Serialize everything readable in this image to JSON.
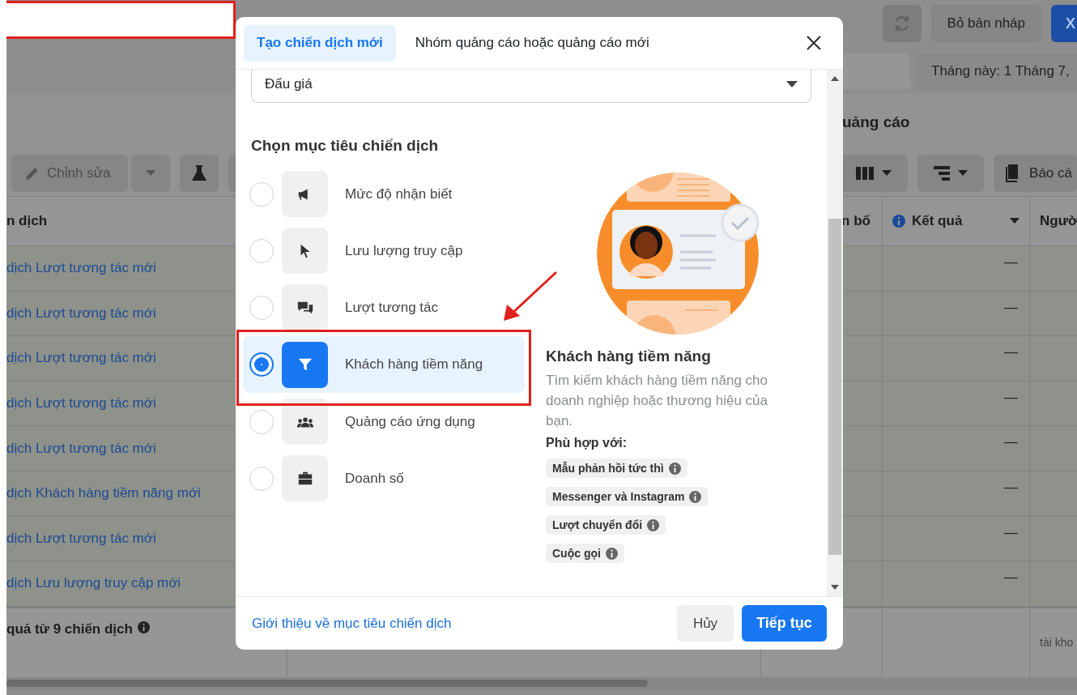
{
  "header": {
    "discard_button": "Bỏ bản nháp",
    "publish_button": "X"
  },
  "date_range": "Tháng này: 1 Tháng 7,",
  "section_title": "uảng cáo",
  "toolbar": {
    "edit_button": "Chỉnh sửa",
    "report_button": "Báo cá"
  },
  "table": {
    "columns": [
      {
        "label": "n dịch"
      },
      {
        "label": "n bố"
      },
      {
        "label": "Kết quả"
      },
      {
        "label": "Ngườ"
      }
    ],
    "rows": [
      {
        "name": "dịch Lượt tương tác mới",
        "result": "—"
      },
      {
        "name": "dịch Lượt tương tác mới",
        "result": "—"
      },
      {
        "name": "dịch Lượt tương tác mới",
        "result": "—"
      },
      {
        "name": "dịch Lượt tương tác mới",
        "result": "—"
      },
      {
        "name": "dịch Lượt tương tác mới",
        "result": "—"
      },
      {
        "name": "dịch Khách hàng tiềm năng mới",
        "result": "—"
      },
      {
        "name": "dịch Lượt tương tác mới",
        "result": "—"
      },
      {
        "name": "dịch Lưu lượng truy cập mới",
        "result": "—"
      }
    ],
    "summary": {
      "label": "quả từ 9 chiến dịch",
      "note": "tài kho"
    }
  },
  "modal": {
    "tabs": [
      {
        "label": "Tạo chiến dịch mới",
        "selected": true
      },
      {
        "label": "Nhóm quảng cáo hoặc quảng cáo mới",
        "selected": false
      }
    ],
    "dropdown": {
      "value": "Đấu giá"
    },
    "heading": "Chọn mục tiêu chiến dịch",
    "objectives": [
      {
        "label": "Mức độ nhận biết",
        "kind": "megaphone",
        "selected": false
      },
      {
        "label": "Lưu lượng truy cập",
        "kind": "cursor",
        "selected": false
      },
      {
        "label": "Lượt tương tác",
        "kind": "chat",
        "selected": false
      },
      {
        "label": "Khách hàng tiềm năng",
        "kind": "funnel",
        "selected": true
      },
      {
        "label": "Quảng cáo ứng dụng",
        "kind": "people",
        "selected": false
      },
      {
        "label": "Doanh số",
        "kind": "briefcase",
        "selected": false
      }
    ],
    "detail": {
      "title": "Khách hàng tiềm năng",
      "description": "Tìm kiếm khách hàng tiềm năng cho doanh nghiệp hoặc thương hiệu của bạn.",
      "fit_label": "Phù hợp với:",
      "tags": [
        "Mẫu phản hồi tức thì",
        "Messenger và Instagram",
        "Lượt chuyển đổi",
        "Cuộc gọi"
      ]
    },
    "link": "Giới thiệu về mục tiêu chiến dịch",
    "cancel_button": "Hủy",
    "continue_button": "Tiếp tục"
  }
}
